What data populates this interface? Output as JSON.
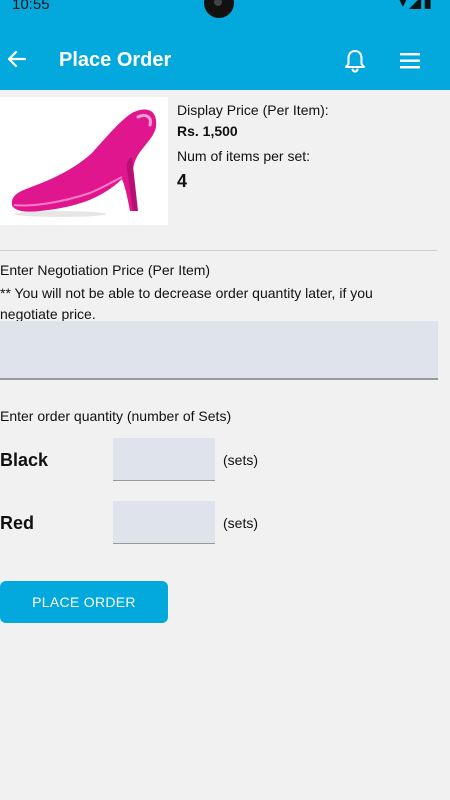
{
  "status_bar": {
    "time": "10:55",
    "icons": "▾◢▮"
  },
  "app_bar": {
    "title": "Place Order",
    "back_icon": "arrow-left",
    "bell_icon": "bell",
    "menu_icon": "hamburger-menu"
  },
  "product": {
    "display_price_label": "Display Price (Per Item):",
    "display_price_value": "Rs. 1,500",
    "items_per_set_label": "Num of items per set:",
    "items_per_set_value": "4"
  },
  "negotiation": {
    "label": "Enter Negotiation Price (Per Item)",
    "note": "** You will not be able to decrease order quantity later, if you negotiate price.",
    "value": ""
  },
  "order_quantity": {
    "label": "Enter order quantity (number of Sets)",
    "colors": [
      {
        "name": "Black",
        "value": "",
        "unit": "(sets)"
      },
      {
        "name": "Red",
        "value": "",
        "unit": "(sets)"
      }
    ]
  },
  "place_order_button": "PLACE ORDER",
  "colors": {
    "primary": "#03a9dc",
    "input_bg": "#dfe3ec",
    "background": "#f1f1f1",
    "shoe": "#e0168e"
  }
}
